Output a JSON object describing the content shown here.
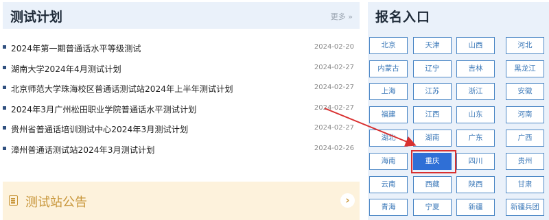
{
  "plan": {
    "title": "测试计划",
    "more_label": "更多 »",
    "items": [
      {
        "title": "2024年第一期普通话水平等级测试",
        "date": "2024-02-20"
      },
      {
        "title": "湖南大学2024年4月测试计划",
        "date": "2024-02-27"
      },
      {
        "title": "北京师范大学珠海校区普通话测试站2024年上半年测试计划",
        "date": "2024-02-27"
      },
      {
        "title": "2024年3月广州松田职业学院普通话水平测试计划",
        "date": "2024-02-27"
      },
      {
        "title": "贵州省普通话培训测试中心2024年3月测试计划",
        "date": "2024-02-27"
      },
      {
        "title": "漳州普通话测试站2024年3月测试计划",
        "date": "2024-02-26"
      }
    ]
  },
  "notice": {
    "title": "测试站公告",
    "icon": "clipboard-icon",
    "arrow_icon": "chevron-right-icon",
    "arrow_glyph": "›"
  },
  "registration": {
    "title": "报名入口",
    "provinces": [
      "北京",
      "天津",
      "山西",
      "河北",
      "内蒙古",
      "辽宁",
      "吉林",
      "黑龙江",
      "上海",
      "江苏",
      "浙江",
      "安徽",
      "福建",
      "江西",
      "山东",
      "河南",
      "湖北",
      "湖南",
      "广东",
      "广西",
      "海南",
      "重庆",
      "四川",
      "贵州",
      "云南",
      "西藏",
      "陕西",
      "甘肃",
      "青海",
      "宁夏",
      "新疆",
      "新疆兵团"
    ],
    "selected": "重庆"
  },
  "colors": {
    "accent_blue": "#2f6fd6",
    "highlight_red": "#d93030",
    "header_bg": "#eaf1fa",
    "notice_gold": "#c8963a"
  }
}
